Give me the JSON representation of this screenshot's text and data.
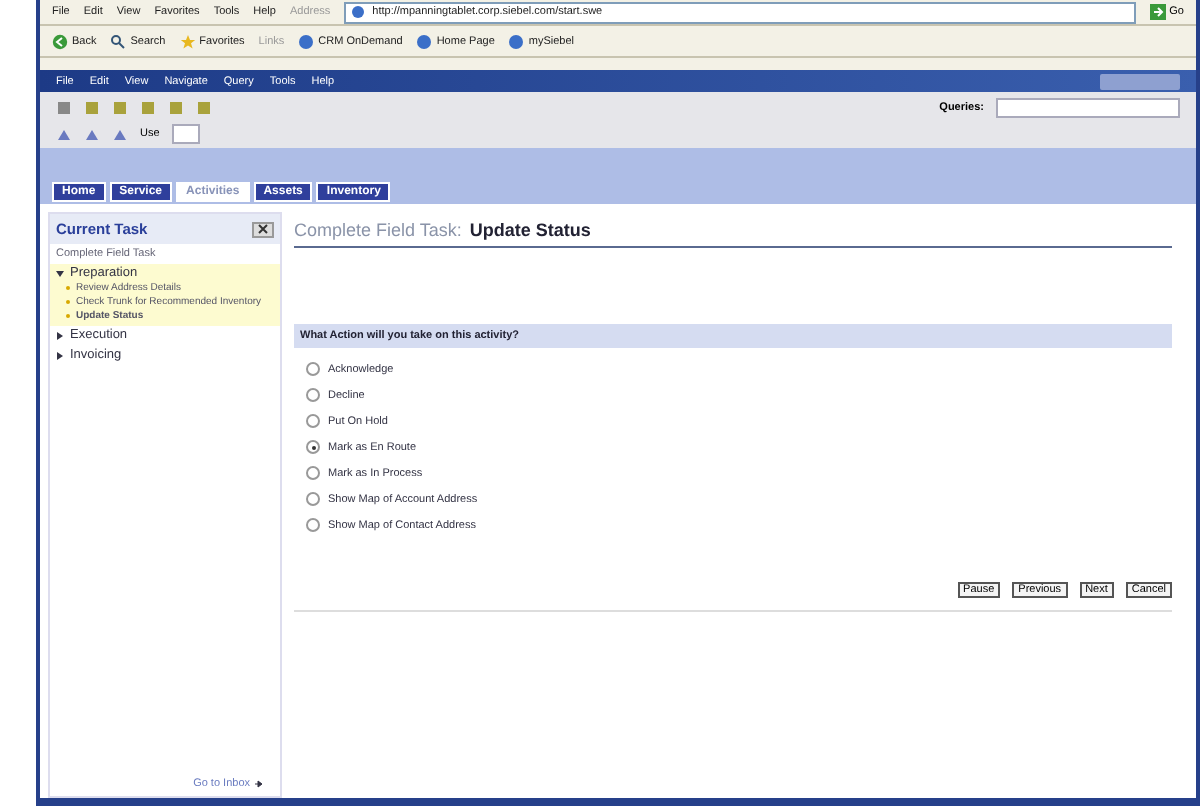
{
  "browser": {
    "menu": [
      "File",
      "Edit",
      "View",
      "Favorites",
      "Tools",
      "Help"
    ],
    "address_label": "Address",
    "url": "http://mpanningtablet.corp.siebel.com/start.swe",
    "go": "Go",
    "toolbar": [
      {
        "kind": "back",
        "label": "Back"
      },
      {
        "kind": "search",
        "label": "Search"
      },
      {
        "kind": "favorites",
        "label": "Favorites"
      }
    ],
    "links_label": "Links",
    "links": [
      "CRM OnDemand",
      "Home Page",
      "mySiebel"
    ]
  },
  "app": {
    "menu": [
      "File",
      "Edit",
      "View",
      "Navigate",
      "Query",
      "Tools",
      "Help"
    ],
    "queries_label": "Queries:",
    "use_label": "Use",
    "tabs": [
      {
        "label": "Home",
        "selected": false
      },
      {
        "label": "Service",
        "selected": false
      },
      {
        "label": "Activities",
        "selected": true
      },
      {
        "label": "Assets",
        "selected": false
      },
      {
        "label": "Inventory",
        "selected": false
      }
    ]
  },
  "task_pane": {
    "title": "Current Task",
    "task": "Complete Field Task",
    "steps": [
      {
        "label": "Preparation",
        "expanded": true,
        "children": [
          {
            "label": "Review Address Details",
            "selected": false
          },
          {
            "label": "Check Trunk for Recommended Inventory",
            "selected": false
          },
          {
            "label": "Update Status",
            "selected": true
          }
        ]
      },
      {
        "label": "Execution",
        "expanded": false
      },
      {
        "label": "Invoicing",
        "expanded": false
      }
    ],
    "inbox_link": "Go to Inbox"
  },
  "form": {
    "title": "Complete Field Task:",
    "subtitle": "Update Status",
    "question": "What Action will you take on this activity?",
    "options": [
      {
        "label": "Acknowledge",
        "selected": false
      },
      {
        "label": "Decline",
        "selected": false
      },
      {
        "label": "Put On Hold",
        "selected": false
      },
      {
        "label": "Mark as En Route",
        "selected": true
      },
      {
        "label": "Mark as In Process",
        "selected": false
      },
      {
        "label": "Show Map of Account Address",
        "selected": false
      },
      {
        "label": "Show Map of Contact Address",
        "selected": false
      }
    ],
    "buttons": [
      "Pause",
      "Previous",
      "Next",
      "Cancel"
    ]
  }
}
